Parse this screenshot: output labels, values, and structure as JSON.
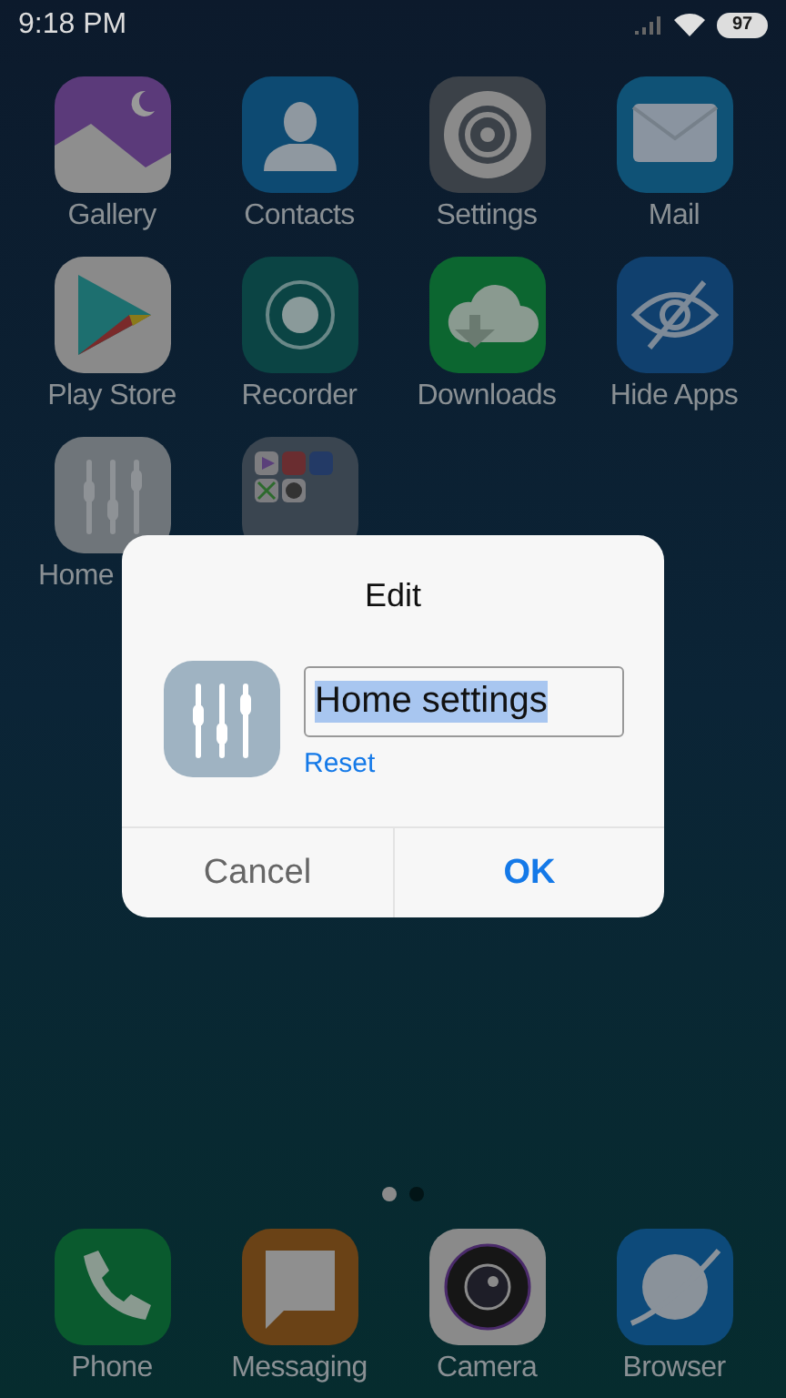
{
  "status_bar": {
    "time": "9:18 PM",
    "battery": "97"
  },
  "apps": [
    {
      "label": "Gallery",
      "kind": "gallery"
    },
    {
      "label": "Contacts",
      "kind": "contacts"
    },
    {
      "label": "Settings",
      "kind": "settings"
    },
    {
      "label": "Mail",
      "kind": "mail"
    },
    {
      "label": "Play Store",
      "kind": "play"
    },
    {
      "label": "Recorder",
      "kind": "recorder"
    },
    {
      "label": "Downloads",
      "kind": "downloads"
    },
    {
      "label": "Hide Apps",
      "kind": "hide"
    },
    {
      "label": "Home",
      "kind": "sliders"
    },
    {
      "kind": "folder"
    }
  ],
  "page_dots": [
    {
      "selected": true
    },
    {
      "selected": false
    }
  ],
  "dock": [
    {
      "label": "Phone",
      "kind": "phone"
    },
    {
      "label": "Messaging",
      "kind": "messaging"
    },
    {
      "label": "Camera",
      "kind": "camera"
    },
    {
      "label": "Browser",
      "kind": "browser"
    }
  ],
  "dialog": {
    "title": "Edit",
    "icon": {
      "kind": "sliders"
    },
    "name_field": {
      "value": "Home settings",
      "selected": true
    },
    "link": "Reset",
    "buttons": [
      {
        "label": "Cancel",
        "primary": false
      },
      {
        "label": "OK",
        "primary": true
      }
    ]
  }
}
